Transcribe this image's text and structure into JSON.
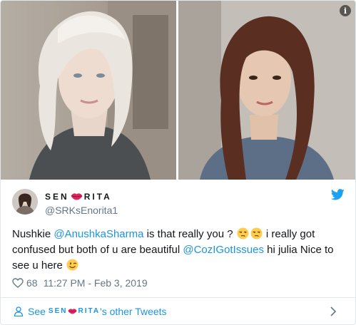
{
  "user": {
    "display_name_parts": [
      "SEN",
      "RITA"
    ],
    "handle": "@SRKsEnorita1"
  },
  "tweet": {
    "text_1": "Nushkie ",
    "mention_1": "@AnushkaSharma",
    "text_2": " is that really you ? ",
    "text_3": "  i really got confused but both of u are beautiful ",
    "mention_2": "@CozIGotIssues",
    "text_4": " hi julia Nice to see u here "
  },
  "meta": {
    "likes": "68",
    "timestamp": "11:27 PM - Feb 3, 2019"
  },
  "footer": {
    "see_prefix": "See",
    "see_name_parts": [
      "SEN",
      "RITA"
    ],
    "see_suffix": "'s other Tweets"
  },
  "media": {
    "info_label": "i"
  },
  "colors": {
    "link": "#1b95e0",
    "secondary_text": "#657786",
    "border": "#e1e8ed",
    "lips": "#e0245e"
  },
  "icons": [
    "info-icon",
    "twitter-bird-icon",
    "lips-icon",
    "unamused-face-icon",
    "winking-face-icon",
    "heart-icon",
    "person-icon",
    "chevron-right-icon"
  ]
}
